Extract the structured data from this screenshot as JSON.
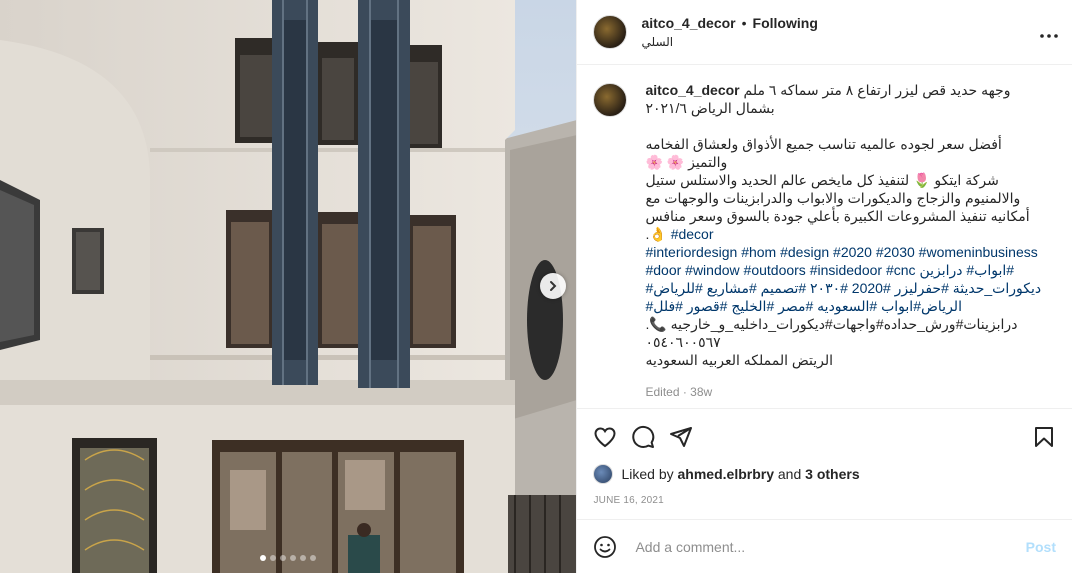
{
  "header": {
    "username": "aitco_4_decor",
    "separator": "•",
    "follow_status": "Following",
    "location": "السلي",
    "more_icon": "more-horizontal-icon"
  },
  "media": {
    "alt": "building facade with laser-cut iron strips",
    "slide_count": 6,
    "active_slide": 1,
    "next_icon": "chevron-right-icon"
  },
  "caption": {
    "username": "aitco_4_decor",
    "line1": "وجهه حديد قص ليزر ارتفاع ٨ متر سماكه ٦ ملم بشمال الرياض ٢٠٢١/٦",
    "p2": "أفضل سعر لجوده عالميه تناسب جميع الأذواق ولعشاق الفخامه والتميز 🌸 🌸",
    "p3a": "شركة ايتكو 🌷 لتنفيذ كل مايخص عالم الحديد والاستلس ستيل والالمنيوم والزجاج والديكورات والابواب والدرابزينات والوجهات مع أمكانيه تنفيذ المشروعات الكبيرة بأعلي جودة بالسوق وسعر منافس👌.",
    "tags1": "#decor",
    "tags2": "#interiordesign #hom #design #2020 #2030 #womeninbusiness",
    "tags3": "#door #window #outdoors #insidedoor #cnc ابواب# درابزين#",
    "tags4": "ديكورات_حديثة #حفرليزر #2020 #٢٠٣٠ #تصميم #مشاريع #للرياض#",
    "tags5": "الرياض#ابواب #السعوديه #مصر #الخليج #قصور #فلل#",
    "tags6": "درابزينات#ورش_حداده#واجهات#ديكورات_داخليه_و_خارجيه 📞.",
    "phone": "٠٥٤٠٦٠٠٥٦٧",
    "address": "الريتض المملكه العربيه السعوديه",
    "edited": "Edited · 38w"
  },
  "actions": {
    "like_icon": "heart-icon",
    "comment_icon": "comment-icon",
    "share_icon": "share-icon",
    "save_icon": "bookmark-icon"
  },
  "likes": {
    "prefix": "Liked by",
    "user": "ahmed.elbrbry",
    "and": "and",
    "others": "3 others"
  },
  "date": "JUNE 16, 2021",
  "add_comment": {
    "emoji_icon": "emoji-icon",
    "placeholder": "Add a comment...",
    "post_label": "Post"
  },
  "colors": {
    "hashtag": "#00376b",
    "muted": "#8e8e8e",
    "post_disabled": "#b2dffc"
  }
}
